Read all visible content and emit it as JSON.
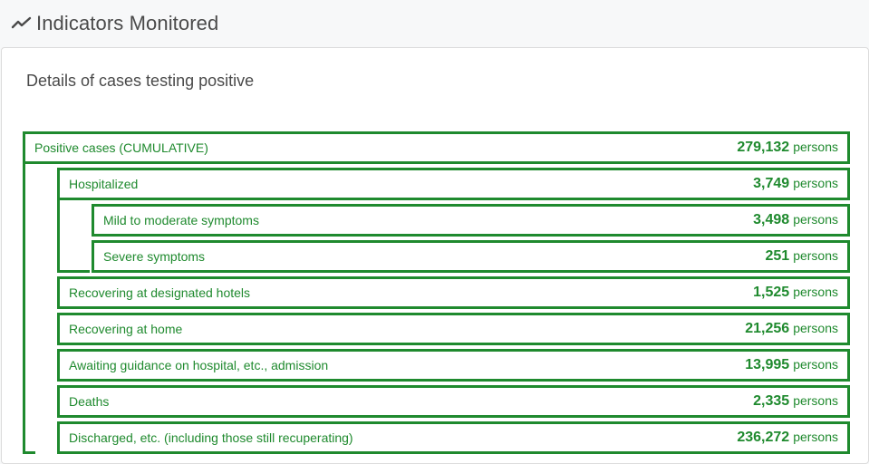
{
  "header": {
    "title": "Indicators Monitored",
    "icon": "trend-line-icon"
  },
  "card": {
    "subtitle": "Details of cases testing positive"
  },
  "unit": "persons",
  "rows": [
    {
      "label": "Positive cases (CUMULATIVE)",
      "value": "279,132"
    },
    {
      "label": "Hospitalized",
      "value": "3,749"
    },
    {
      "label": "Mild to moderate symptoms",
      "value": "3,498"
    },
    {
      "label": "Severe symptoms",
      "value": "251"
    },
    {
      "label": "Recovering at designated hotels",
      "value": "1,525"
    },
    {
      "label": "Recovering at home",
      "value": "21,256"
    },
    {
      "label": "Awaiting guidance on hospital, etc., admission",
      "value": "13,995"
    },
    {
      "label": "Deaths",
      "value": "2,335"
    },
    {
      "label": "Discharged, etc. (including those still recuperating)",
      "value": "236,272"
    }
  ],
  "colors": {
    "accent": "#1f8a2e",
    "title": "#4a4a4a"
  }
}
